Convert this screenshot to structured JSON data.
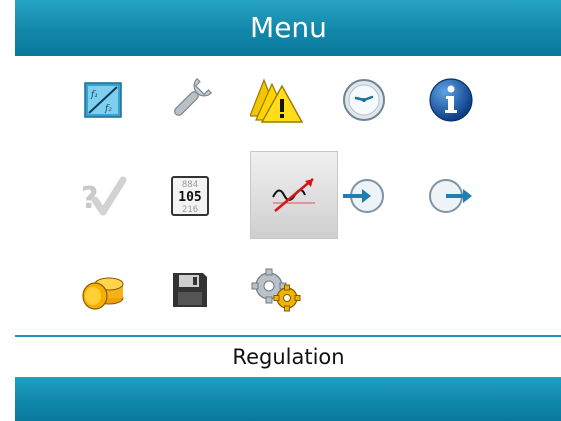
{
  "header": {
    "title": "Menu"
  },
  "menu": {
    "items": [
      {
        "icon": "function-fx-icon"
      },
      {
        "icon": "wrench-icon"
      },
      {
        "icon": "alarm-warnings-icon"
      },
      {
        "icon": "clock-icon"
      },
      {
        "icon": "info-icon"
      },
      {
        "icon": "checklist-question-icon"
      },
      {
        "icon": "counter-display-icon",
        "digits": [
          "884",
          "105",
          "216"
        ]
      },
      {
        "icon": "regulation-trend-icon",
        "selected": true
      },
      {
        "icon": "login-icon"
      },
      {
        "icon": "logout-icon"
      },
      {
        "icon": "coins-icon"
      },
      {
        "icon": "save-floppy-icon"
      },
      {
        "icon": "settings-gears-icon"
      }
    ]
  },
  "status": {
    "label": "Regulation"
  },
  "colors": {
    "accent": "#1387aa",
    "selection": "#d8d8d8"
  }
}
